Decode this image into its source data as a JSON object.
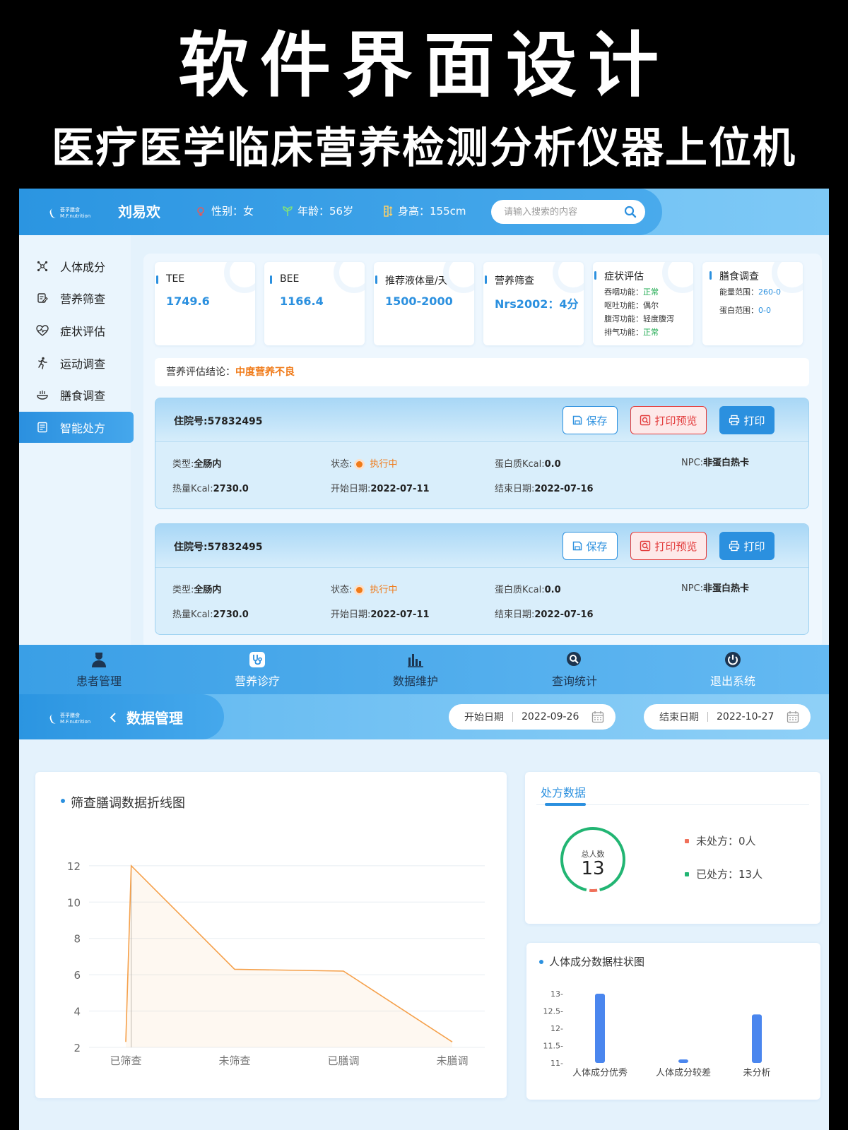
{
  "banner": {
    "title": "软件界面设计",
    "subtitle": "医疗医学临床营养检测分析仪器上位机"
  },
  "logo": {
    "line1": "荟孚膳食",
    "line2": "M.F.nutrition"
  },
  "patient": {
    "name": "刘易欢",
    "gender": "性别：女",
    "age": "年龄：56岁",
    "height": "身高：155cm"
  },
  "search": {
    "placeholder": "请输入搜索的内容"
  },
  "sidebar": {
    "items": [
      {
        "label": "人体成分",
        "icon": "molecule-icon"
      },
      {
        "label": "营养筛查",
        "icon": "clipboard-edit-icon"
      },
      {
        "label": "症状评估",
        "icon": "heart-pulse-icon"
      },
      {
        "label": "运动调查",
        "icon": "running-person-icon"
      },
      {
        "label": "膳食调查",
        "icon": "food-bowl-icon"
      },
      {
        "label": "智能处方",
        "icon": "prescription-icon",
        "active": true
      }
    ]
  },
  "cards": {
    "tee": {
      "title": "TEE",
      "value": "1749.6"
    },
    "bee": {
      "title": "BEE",
      "value": "1166.4"
    },
    "fluid": {
      "title": "推荐液体量/天",
      "value": "1500-2000"
    },
    "screening": {
      "title": "营养筛查",
      "value": "Nrs2002：4分"
    },
    "symptom": {
      "title": "症状评估",
      "rows": [
        {
          "label": "吞咽功能：",
          "value": "正常"
        },
        {
          "label": "呕吐功能：",
          "value": "偶尔"
        },
        {
          "label": "腹泻功能：",
          "value": "轻度腹泻"
        },
        {
          "label": "排气功能：",
          "value": "正常"
        }
      ]
    },
    "diet": {
      "title": "膳食调查",
      "rows": [
        {
          "label": "能量范围：",
          "value": "260-0"
        },
        {
          "label": "蛋白范围：",
          "value": "0-0"
        }
      ]
    }
  },
  "conclusion": {
    "label": "营养评估结论：",
    "value": "中度营养不良"
  },
  "prescriptions": [
    {
      "no_label": "住院号:",
      "no": "57832495",
      "save": "保存",
      "preview": "打印预览",
      "print": "打印",
      "type_label": "类型:",
      "type": "全肠内",
      "status_label": "状态:",
      "status": "执行中",
      "protein_label": "蛋白质Kcal:",
      "protein": "0.0",
      "npc_label": "NPC:",
      "npc": "非蛋白热卡",
      "heat_label": "热量Kcal:",
      "heat": "2730.0",
      "start_label": "开始日期:",
      "start": "2022-07-11",
      "end_label": "结束日期:",
      "end": "2022-07-16"
    },
    {
      "no_label": "住院号:",
      "no": "57832495",
      "save": "保存",
      "preview": "打印预览",
      "print": "打印",
      "type_label": "类型:",
      "type": "全肠内",
      "status_label": "状态:",
      "status": "执行中",
      "protein_label": "蛋白质Kcal:",
      "protein": "0.0",
      "npc_label": "NPC:",
      "npc": "非蛋白热卡",
      "heat_label": "热量Kcal:",
      "heat": "2730.0",
      "start_label": "开始日期:",
      "start": "2022-07-11",
      "end_label": "结束日期:",
      "end": "2022-07-16"
    }
  ],
  "nav": {
    "items": [
      {
        "label": "患者管理",
        "icon": "doctor-icon"
      },
      {
        "label": "营养诊疗",
        "icon": "stethoscope-icon"
      },
      {
        "label": "数据维护",
        "icon": "bar-chart-icon"
      },
      {
        "label": "查询统计",
        "icon": "search-chart-icon"
      },
      {
        "label": "退出系统",
        "icon": "power-icon"
      }
    ]
  },
  "data_mgmt": {
    "title": "数据管理",
    "start_label": "开始日期",
    "start_value": "2022-09-26",
    "end_label": "结束日期",
    "end_value": "2022-10-27"
  },
  "line_panel": {
    "title": "筛查膳调数据折线图"
  },
  "rx_panel": {
    "tab": "处方数据",
    "total_label": "总人数",
    "total": "13",
    "legend": [
      {
        "label": "未处方：0人",
        "color": "#f0705a"
      },
      {
        "label": "已处方：13人",
        "color": "#22b573"
      }
    ]
  },
  "bar_panel": {
    "title": "人体成分数据柱状图"
  },
  "colors": {
    "primary": "#2b90df",
    "accent": "#f07a18",
    "ok": "#1aa84c",
    "danger": "#e23a3a",
    "line": "#f5a04a"
  },
  "chart_data": [
    {
      "type": "line",
      "categories": [
        "已筛查",
        "未筛查",
        "已膳调",
        "未膳调"
      ],
      "x": [
        0,
        0.05,
        1,
        2,
        3
      ],
      "values": [
        2.3,
        12,
        6.3,
        6.2,
        2.3
      ],
      "yticks": [
        2,
        4,
        6,
        8,
        10,
        12
      ],
      "ylim": [
        2,
        12.5
      ],
      "grid": true,
      "title": "筛查膳调数据折线图"
    },
    {
      "type": "pie",
      "values": [
        0,
        13
      ],
      "labels": [
        "未处方",
        "已处方"
      ],
      "total": 13
    },
    {
      "type": "bar",
      "categories": [
        "人体成分优秀",
        "人体成分较差",
        "未分析"
      ],
      "values": [
        13,
        11.1,
        12.4
      ],
      "yticks": [
        "11-",
        "11.5-",
        "12-",
        "12.5-",
        "13-"
      ],
      "ylim": [
        11,
        13
      ],
      "title": "人体成分数据柱状图"
    }
  ]
}
